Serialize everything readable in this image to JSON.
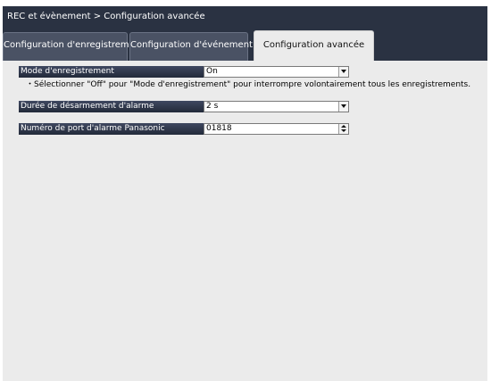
{
  "window": {
    "breadcrumb": "REC et évènement > Configuration avancée"
  },
  "tabs": [
    {
      "label": "Configuration d'enregistrement",
      "active": false
    },
    {
      "label": "Configuration d'événement",
      "active": false
    },
    {
      "label": "Configuration avancée",
      "active": true
    }
  ],
  "settings": {
    "recording_mode": {
      "label": "Mode d'enregistrement",
      "value": "On"
    },
    "recording_note": "・Sélectionner \"Off\" pour \"Mode d'enregistrement\" pour interrompre volontairement tous les enregistrements.",
    "alarm_disarm_duration": {
      "label": "Durée de désarmement d'alarme",
      "value": "2 s"
    },
    "panasonic_alarm_port": {
      "label": "Numéro de port d'alarme Panasonic",
      "value": "01818"
    }
  },
  "colors": {
    "frame": "#2a3242",
    "content_bg": "#ebebeb",
    "label_bg": "#2c3447"
  },
  "icons": {
    "dropdown": "chevron-down-icon",
    "spinner": "spinner-arrows-icon"
  }
}
